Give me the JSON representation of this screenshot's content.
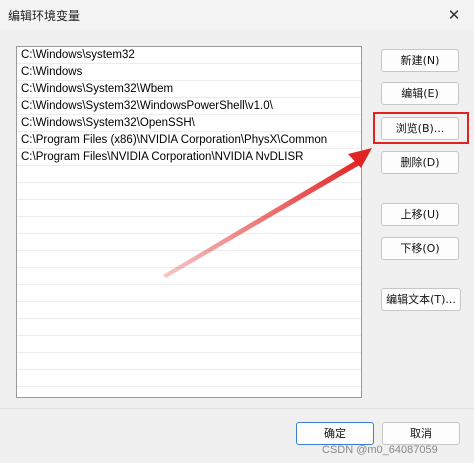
{
  "window": {
    "title": "编辑环境变量",
    "close_glyph": "✕"
  },
  "paths": [
    "C:\\Windows\\system32",
    "C:\\Windows",
    "C:\\Windows\\System32\\Wbem",
    "C:\\Windows\\System32\\WindowsPowerShell\\v1.0\\",
    "C:\\Windows\\System32\\OpenSSH\\",
    "C:\\Program Files (x86)\\NVIDIA Corporation\\PhysX\\Common",
    "C:\\Program Files\\NVIDIA Corporation\\NVIDIA NvDLISR"
  ],
  "buttons": {
    "new": "新建(N)",
    "edit": "编辑(E)",
    "browse": "浏览(B)...",
    "delete": "删除(D)",
    "move_up": "上移(U)",
    "move_down": "下移(O)",
    "edit_text": "编辑文本(T)...",
    "ok": "确定",
    "cancel": "取消"
  },
  "annotation": {
    "color": "#e02424"
  },
  "watermark": "CSDN @m0_64087059"
}
